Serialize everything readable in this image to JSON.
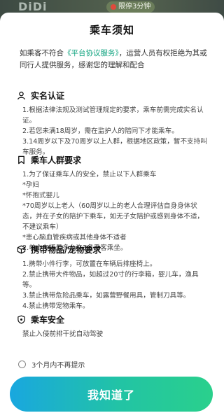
{
  "background": {
    "logo_text": "DiDi",
    "badge_text": "限停3分钟"
  },
  "dialog": {
    "title": "乘车须知",
    "intro_prefix": "如乘客不符合",
    "intro_link": "《平台协议服务》",
    "intro_suffix": "，运营人员有权拒绝为其或同行人提供服务，感谢您的理解和配合",
    "sections": [
      {
        "icon": "person-icon",
        "title": "实名认证",
        "lines": [
          "1.根据法律法规及测试管理规定的要求，乘车前需完成实名认证。",
          "2.若您未满18周岁，需在监护人的陪同下才能乘车。",
          "3.14周岁以下及70周岁以上人群，根据地区政策，暂不支持叫车服务。"
        ]
      },
      {
        "icon": "bookmark-icon",
        "title": "乘车人群要求",
        "lines": [
          "1.为了保证乘车人的安全，禁止以下人群乘车",
          "*孕妇",
          "*怀抱式婴儿",
          "*70周岁以上老人（60周岁以上的老人合理评估自身身体状态，并在子女的陪护下乘车，如无子女陪护或感到身体不适，不建议乘车）",
          "*患心脑血管疾病或其他身体不适者",
          "2.单个车辆最多允许3名乘客乘坐。"
        ]
      },
      {
        "icon": "box-icon",
        "title": "携带物品/宠物要求",
        "lines": [
          "1.携带小件行李，可放置在车辆后排座椅上。",
          "2.禁止携带大件物品，如超过20寸的行李箱，婴儿车，渔具等。",
          "3.禁止携带危险品乘车，如露营野餐用具，管制刀具等。",
          "4.禁止携带宠物乘车。"
        ]
      },
      {
        "icon": "shield-icon",
        "title": "乘车安全",
        "lines": [
          "禁止入侵前排干扰自动驾驶"
        ]
      }
    ],
    "remind_label": "3个月内不再提示",
    "confirm_label": "我知道了"
  }
}
